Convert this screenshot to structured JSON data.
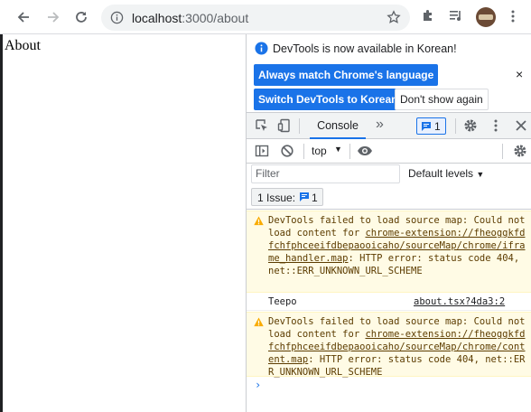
{
  "browser": {
    "url_host": "localhost",
    "url_path": ":3000/about"
  },
  "page": {
    "title": "About"
  },
  "devtools": {
    "notice": {
      "message": "DevTools is now available in Korean!",
      "match_language_label": "Always match Chrome's language",
      "switch_label": "Switch DevTools to Korean",
      "dont_show_label": "Don't show again",
      "close_symbol": "×"
    },
    "tabs": {
      "console_label": "Console",
      "more_symbol": "»",
      "issues_count": "1"
    },
    "console_toolbar": {
      "context": "top"
    },
    "filter": {
      "placeholder": "Filter",
      "levels_label": "Default levels"
    },
    "issues": {
      "label": "1 Issue:",
      "count": "1"
    },
    "messages": [
      {
        "type": "warning",
        "prefix": "DevTools failed to load source map: Could not load content for ",
        "link": "chrome-extension://fheoggkfdfchfphceeifdbepaooicaho/sourceMap/chrome/iframe_handler.map",
        "suffix": ": HTTP error: status code 404, net::ERR_UNKNOWN_URL_SCHEME"
      },
      {
        "type": "log",
        "text": "Teepo",
        "source": "about.tsx?4da3:2"
      },
      {
        "type": "warning",
        "prefix": "DevTools failed to load source map: Could not load content for ",
        "link": "chrome-extension://fheoggkfdfchfphceeifdbepaooicaho/sourceMap/chrome/content.map",
        "suffix": ": HTTP error: status code 404, net::ERR_UNKNOWN_URL_SCHEME"
      }
    ],
    "prompt_symbol": "›"
  },
  "colors": {
    "accent": "#1a73e8",
    "warning_bg": "#fffbe5",
    "warning_icon": "#f9ab00"
  }
}
